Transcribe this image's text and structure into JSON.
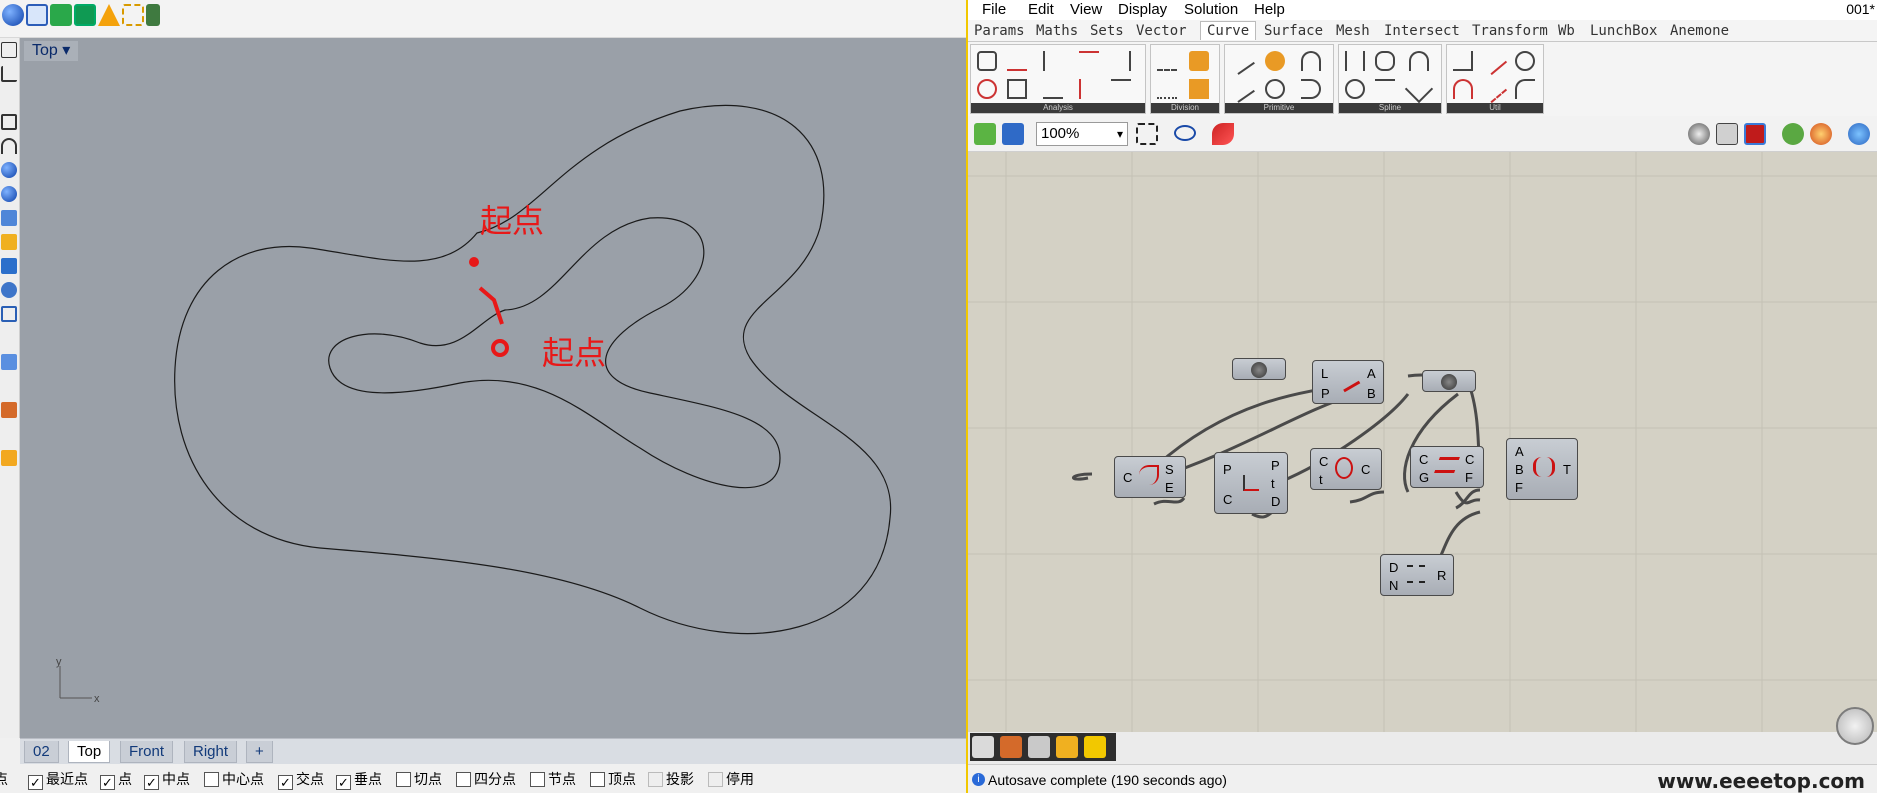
{
  "rhino": {
    "viewport_label": "Top",
    "annotation_1": "起点",
    "annotation_2": "起点",
    "axis_x": "x",
    "axis_y": "y",
    "view_tabs": [
      "02",
      "Top",
      "Front",
      "Right",
      "+"
    ],
    "active_view_tab": "Top",
    "osnaps": [
      {
        "label": "点",
        "checked": true
      },
      {
        "label": "最近点",
        "checked": true
      },
      {
        "label": "点",
        "checked": true
      },
      {
        "label": "中点",
        "checked": true
      },
      {
        "label": "中心点",
        "checked": false
      },
      {
        "label": "交点",
        "checked": true
      },
      {
        "label": "垂点",
        "checked": true
      },
      {
        "label": "切点",
        "checked": false
      },
      {
        "label": "四分点",
        "checked": false
      },
      {
        "label": "节点",
        "checked": false
      },
      {
        "label": "顶点",
        "checked": false
      },
      {
        "label": "投影",
        "checked": false
      },
      {
        "label": "停用",
        "checked": false
      }
    ]
  },
  "gh": {
    "menu": [
      "File",
      "Edit",
      "View",
      "Display",
      "Solution",
      "Help"
    ],
    "title_right": "001*",
    "tabs": [
      "Params",
      "Maths",
      "Sets",
      "Vector",
      "Curve",
      "Surface",
      "Mesh",
      "Intersect",
      "Transform",
      "Wb",
      "LunchBox",
      "Anemone"
    ],
    "active_tab": "Curve",
    "ribbon_groups": [
      "Analysis",
      "Division",
      "Primitive",
      "Spline",
      "Util"
    ],
    "zoom": "100%",
    "nodes": {
      "lp": {
        "in": [
          "L",
          "P"
        ],
        "out": [
          "A",
          "B"
        ]
      },
      "cse": {
        "in": [
          "C"
        ],
        "out": [
          "S",
          "E"
        ]
      },
      "ptd": {
        "in": [
          "P",
          "C"
        ],
        "out": [
          "P",
          "t",
          "D"
        ]
      },
      "ctc": {
        "in": [
          "C",
          "t"
        ],
        "out": [
          "C"
        ]
      },
      "cgcf": {
        "in": [
          "C",
          "G"
        ],
        "out": [
          "C",
          "F"
        ]
      },
      "abft": {
        "in": [
          "A",
          "B",
          "F"
        ],
        "out": [
          "T"
        ]
      },
      "dnr": {
        "in": [
          "D",
          "N"
        ],
        "out": [
          "R"
        ]
      }
    },
    "status": "Autosave complete (190 seconds ago)",
    "watermark": "www.eeeetop.com"
  },
  "colors": {
    "viewport_bg": "#9aa0a8",
    "annotation": "#e81818",
    "gh_canvas": "#d4d1c5",
    "gh_accent": "#f2c800"
  }
}
